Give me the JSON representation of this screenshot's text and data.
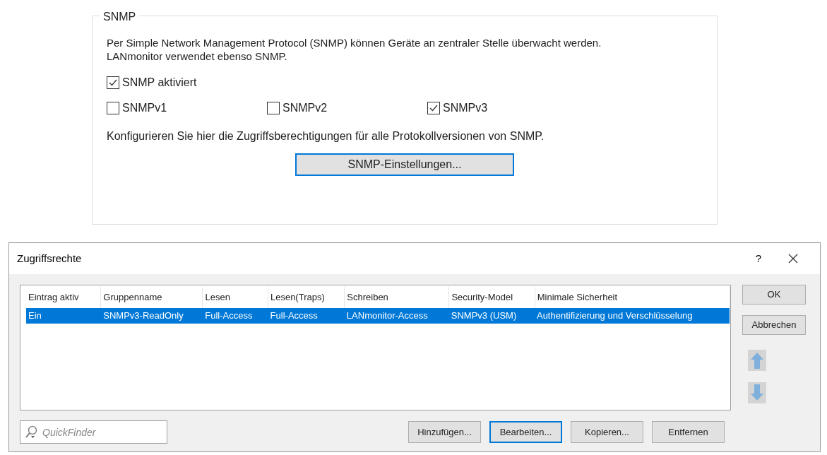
{
  "snmp_group": {
    "title": "SNMP",
    "description": "Per Simple Network Management Protocol (SNMP) können Geräte an zentraler Stelle überwacht werden. LANmonitor verwendet ebenso SNMP.",
    "enable_checkbox": {
      "label": "SNMP aktiviert",
      "checked": true
    },
    "version_checkboxes": [
      {
        "label": "SNMPv1",
        "checked": false
      },
      {
        "label": "SNMPv2",
        "checked": false
      },
      {
        "label": "SNMPv3",
        "checked": true
      }
    ],
    "hint": "Konfigurieren Sie hier die Zugriffsberechtigungen für alle Protokollversionen von SNMP.",
    "settings_button": {
      "label": "SNMP-Einstellungen...",
      "focused": true
    }
  },
  "dialog": {
    "title": "Zugriffsrechte",
    "help_button": "?",
    "table": {
      "columns": [
        "Eintrag aktiv",
        "Gruppenname",
        "Lesen",
        "Lesen(Traps)",
        "Schreiben",
        "Security-Model",
        "Minimale Sicherheit"
      ],
      "rows": [
        {
          "selected": true,
          "cells": [
            "Ein",
            "SNMPv3-ReadOnly",
            "Full-Access",
            "Full-Access",
            "LANmonitor-Access",
            "SNMPv3 (USM)",
            "Authentifizierung und Verschlüsselung"
          ]
        }
      ]
    },
    "side_buttons": [
      {
        "label": "OK",
        "focused": false
      },
      {
        "label": "Abbrechen",
        "focused": false
      }
    ],
    "search": {
      "placeholder": "QuickFinder"
    },
    "bottom_buttons": [
      {
        "label": "Hinzufügen...",
        "focused": false
      },
      {
        "label": "Bearbeiten...",
        "focused": true
      },
      {
        "label": "Kopieren...",
        "focused": false
      },
      {
        "label": "Entfernen",
        "focused": false
      }
    ]
  }
}
